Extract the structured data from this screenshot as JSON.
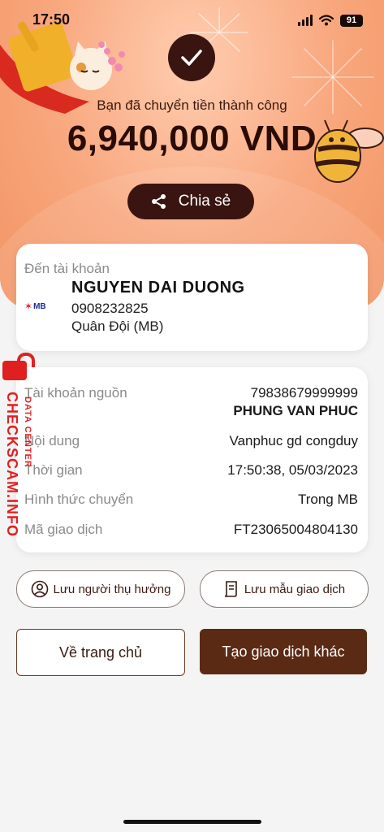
{
  "status_bar": {
    "time": "17:50",
    "battery": "91"
  },
  "hero": {
    "success_text": "Bạn đã chuyển tiền thành công",
    "amount": "6,940,000 VND",
    "share_label": "Chia sẻ"
  },
  "recipient": {
    "label": "Đến tài khoản",
    "bank_logo": "MB",
    "name": "NGUYEN DAI DUONG",
    "account": "0908232825",
    "bank": "Quân Đội (MB)"
  },
  "details": {
    "source_label": "Tài khoản nguồn",
    "source_account": "79838679999999",
    "source_name": "PHUNG VAN PHUC",
    "content_label": "Nội dung",
    "content_value": "Vanphuc gd congduy",
    "time_label": "Thời gian",
    "time_value": "17:50:38, 05/03/2023",
    "method_label": "Hình thức chuyển",
    "method_value": "Trong MB",
    "txid_label": "Mã giao dịch",
    "txid_value": "FT23065004804130"
  },
  "actions": {
    "save_beneficiary": "Lưu người thụ hưởng",
    "save_template": "Lưu mẫu giao dịch",
    "home": "Về trang chủ",
    "new_transaction": "Tạo giao dịch khác"
  },
  "watermark": {
    "main": "CHECKSCAM.INFO",
    "sub": "DATA CENTER"
  },
  "colors": {
    "brand_dark": "#3a1410",
    "button_brown": "#5b2a14",
    "hero_orange": "#f8a67c",
    "watermark_red": "#e02020"
  }
}
